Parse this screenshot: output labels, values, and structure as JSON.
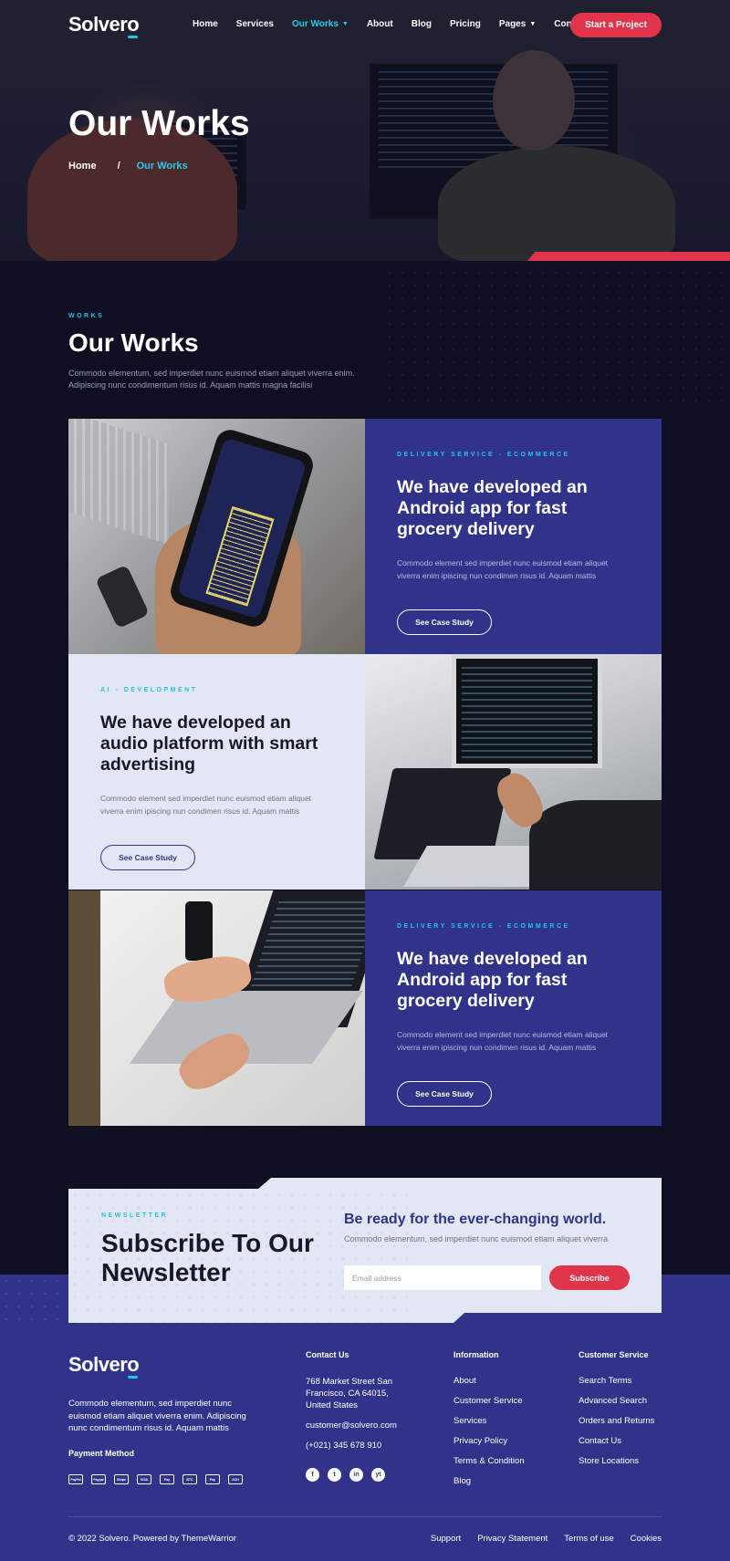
{
  "brand": {
    "name_pre": "Solver",
    "name_o": "o",
    "accent": "#23c3e8",
    "red": "#e0344b",
    "indigo": "#31338a"
  },
  "nav": {
    "items": [
      "Home",
      "Services",
      "Our Works",
      "About",
      "Blog",
      "Pricing",
      "Pages",
      "Contact"
    ],
    "active": "Our Works",
    "cta": "Start a Project"
  },
  "hero": {
    "title": "Our Works",
    "breadcrumb_home": "Home",
    "breadcrumb_sep": "/",
    "breadcrumb_current": "Our Works"
  },
  "section": {
    "kicker": "WORKS",
    "title": "Our Works",
    "description": "Commodo elementum, sed imperdiet nunc euismod etiam aliquet viverra enim. Adipiscing nunc condimentum risus id. Aquam mattis magna facilisi"
  },
  "works": [
    {
      "kicker": "DELIVERY SERVICE - ECOMMERCE",
      "title": "We have developed an Android app for fast grocery delivery",
      "desc": "Commodo element sed imperdiet nunc euismod etiam aliquet viverra enim ipiscing nun condimen risus id. Aquam mattis",
      "button": "See Case Study"
    },
    {
      "kicker": "AI - DEVELOPMENT",
      "title": "We have developed an audio platform with smart advertising",
      "desc": "Commodo element sed imperdiet nunc euismod etiam aliquet viverra enim ipiscing nun condimen risus id. Aquam mattis",
      "button": "See Case Study"
    },
    {
      "kicker": "DELIVERY SERVICE - ECOMMERCE",
      "title": "We have developed an Android app for fast grocery delivery",
      "desc": "Commodo element sed imperdiet nunc euismod etiam aliquet viverra enim ipiscing nun condimen risus id. Aquam mattis",
      "button": "See Case Study"
    }
  ],
  "newsletter": {
    "kicker": "NEWSLETTER",
    "title": "Subscribe To Our Newsletter",
    "heading": "Be ready for the ever-changing world.",
    "desc": "Commodo elementum, sed imperdiet nunc euismod etiam aliquet viverra",
    "placeholder": "Email address",
    "button": "Subscribe"
  },
  "footer": {
    "about": "Commodo elementum, sed imperdiet nunc euismod etiam aliquet viverra enim. Adipiscing nunc condimentum risus id. Aquam mattis",
    "payment_title": "Payment Method",
    "payments": [
      "PayPal",
      "Paypal",
      "Stripe",
      "VISA",
      "Pay",
      "BTC",
      "Pay",
      "ACH"
    ],
    "contact": {
      "title": "Contact Us",
      "address": "768 Market Street San Francisco, CA 64015, United States",
      "email": "customer@solvero.com",
      "phone": "(+021) 345 678 910"
    },
    "social": [
      "f",
      "t",
      "in",
      "yt"
    ],
    "information": {
      "title": "Information",
      "items": [
        "About",
        "Customer Service",
        "Services",
        "Privacy Policy",
        "Terms & Condition",
        "Blog"
      ]
    },
    "customer_service": {
      "title": "Customer Service",
      "items": [
        "Search Terms",
        "Advanced Search",
        "Orders and Returns",
        "Contact Us",
        "Store Locations"
      ]
    },
    "copyright": "© 2022 Solvero. Powered by ThemeWarrior",
    "legal": [
      "Support",
      "Privacy Statement",
      "Terms of use",
      "Cookies"
    ]
  }
}
